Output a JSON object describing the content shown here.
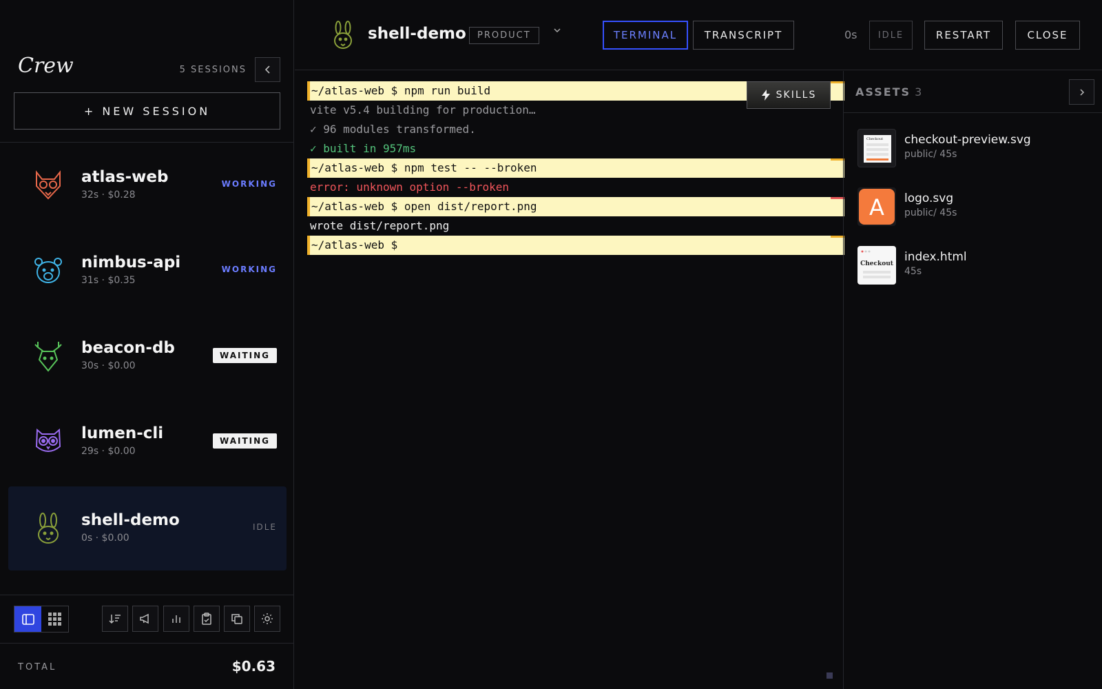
{
  "sidebar": {
    "brand": "Crew",
    "session_count": "5 SESSIONS",
    "new_session_label": "+ NEW SESSION",
    "sessions": [
      {
        "name": "atlas-web",
        "meta": "32s · $0.28",
        "status": "WORKING",
        "avatar": "fox-icon",
        "color": "#e8684a"
      },
      {
        "name": "nimbus-api",
        "meta": "31s · $0.35",
        "status": "WORKING",
        "avatar": "bear-icon",
        "color": "#3fb3e6"
      },
      {
        "name": "beacon-db",
        "meta": "30s · $0.00",
        "status": "WAITING",
        "avatar": "deer-icon",
        "color": "#58c45a"
      },
      {
        "name": "lumen-cli",
        "meta": "29s · $0.00",
        "status": "WAITING",
        "avatar": "owl-icon",
        "color": "#9a6cf0"
      },
      {
        "name": "shell-demo",
        "meta": "0s · $0.00",
        "status": "IDLE",
        "avatar": "rabbit-icon",
        "color": "#8aa03a"
      }
    ],
    "total_label": "TOTAL",
    "total_value": "$0.63"
  },
  "header": {
    "title": "shell-demo",
    "tag": "PRODUCT",
    "tabs": [
      {
        "label": "TERMINAL",
        "active": true
      },
      {
        "label": "TRANSCRIPT",
        "active": false
      }
    ],
    "timer": "0s",
    "status": "IDLE",
    "restart_label": "RESTART",
    "close_label": "CLOSE"
  },
  "terminal": {
    "skills_label": "SKILLS",
    "lines": [
      {
        "type": "cmd",
        "text": "~/atlas-web $ npm run build",
        "mark": "#f0b12a"
      },
      {
        "type": "dim",
        "text": "vite v5.4 building for production…"
      },
      {
        "type": "dim",
        "text": "✓ 96 modules transformed."
      },
      {
        "type": "ok",
        "text": "✓ built in 957ms"
      },
      {
        "type": "cmd",
        "text": "~/atlas-web $ npm test -- --broken",
        "mark": "#f0b12a"
      },
      {
        "type": "err",
        "text": "error: unknown option --broken"
      },
      {
        "type": "cmd",
        "text": "~/atlas-web $ open dist/report.png",
        "mark": "#e85a5a"
      },
      {
        "type": "plain",
        "text": "wrote dist/report.png"
      },
      {
        "type": "cmd",
        "text": "~/atlas-web $ ",
        "mark": "#f0b12a"
      }
    ]
  },
  "assets": {
    "title": "ASSETS",
    "count": "3",
    "items": [
      {
        "name": "checkout-preview.svg",
        "path": "public/ 45s",
        "thumb_text": "Checkout"
      },
      {
        "name": "logo.svg",
        "path": "public/ 45s",
        "thumb_text": "A"
      },
      {
        "name": "index.html",
        "path": "45s",
        "thumb_text": "Checkout"
      }
    ]
  },
  "colors": {
    "accent": "#3651ff",
    "working": "#6b7cff",
    "prompt_bg": "#fdf6c0",
    "error": "#f0555a",
    "success": "#54c47c"
  }
}
